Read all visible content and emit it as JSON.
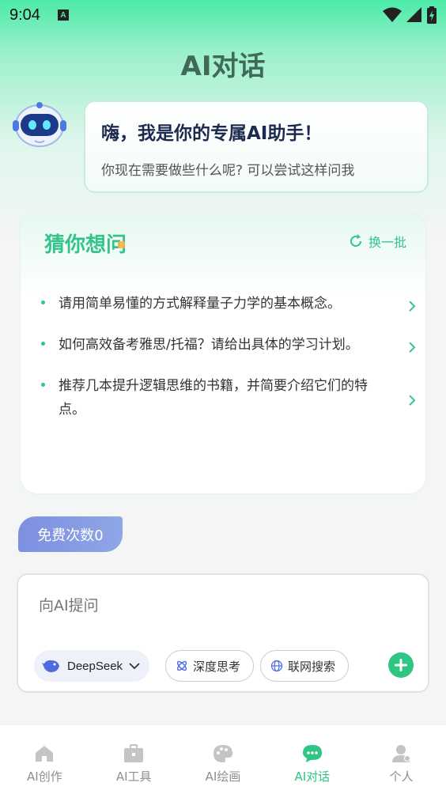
{
  "status_bar": {
    "time": "9:04",
    "notif_letter": "A",
    "icons": [
      "wifi-icon",
      "signal-icon",
      "battery-charging-icon"
    ]
  },
  "page": {
    "title": "AI对话"
  },
  "greeting": {
    "title": "嗨，我是你的专属AI助手！",
    "subtitle": "你现在需要做些什么呢? 可以尝试这样问我"
  },
  "guess": {
    "title_prefix": "猜你想",
    "title_highlight": "问",
    "refresh_label": "换一批",
    "questions": [
      "请用简单易懂的方式解释量子力学的基本概念。",
      "如何高效备考雅思/托福？请给出具体的学习计划。",
      "推荐几本提升逻辑思维的书籍，并简要介绍它们的特点。"
    ]
  },
  "free_tag": {
    "label": "免费次数0"
  },
  "input": {
    "placeholder": "向AI提问",
    "model": "DeepSeek",
    "deep_think": "深度思考",
    "web_search": "联网搜索"
  },
  "tabs": [
    {
      "label": "AI创作",
      "icon": "home-icon",
      "active": false
    },
    {
      "label": "AI工具",
      "icon": "toolbox-icon",
      "active": false
    },
    {
      "label": "AI绘画",
      "icon": "palette-icon",
      "active": false
    },
    {
      "label": "AI对话",
      "icon": "chat-bubble-icon",
      "active": true
    },
    {
      "label": "个人",
      "icon": "person-icon",
      "active": false
    }
  ],
  "colors": {
    "accent": "#2fc684",
    "header_gradient_top": "#4ceaa8",
    "title_text": "#3e6a57",
    "free_tag": "#7e8fe0"
  }
}
